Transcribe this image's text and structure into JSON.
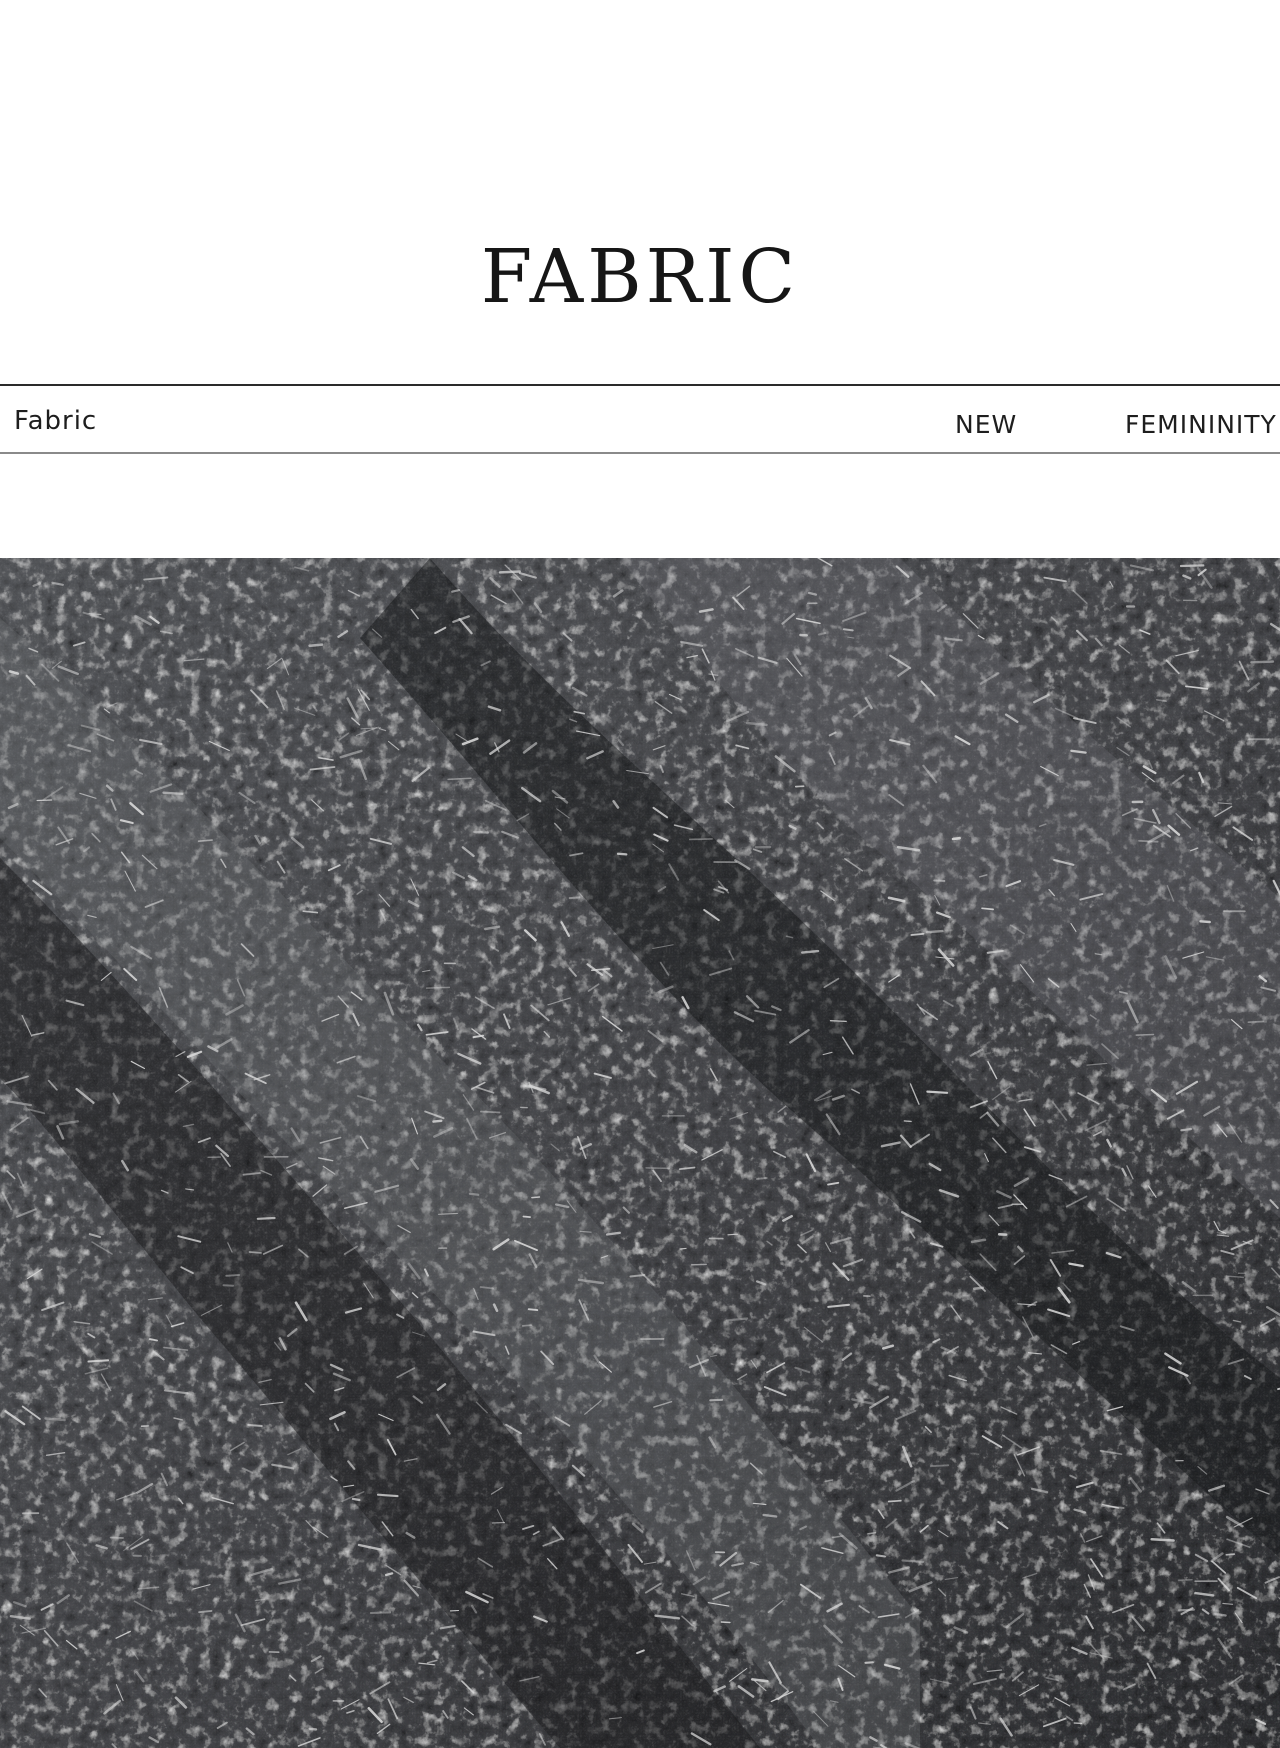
{
  "header": {
    "title": "FABRIC"
  },
  "info_strip": {
    "left_label": "Fabric",
    "tag_new": "NEW",
    "tag_femininity": "FEMININITY"
  },
  "photo": {
    "subject": "fabric-texture-icon",
    "base_color": "#3c3d40",
    "highlight_color": "#d9d9d9"
  }
}
